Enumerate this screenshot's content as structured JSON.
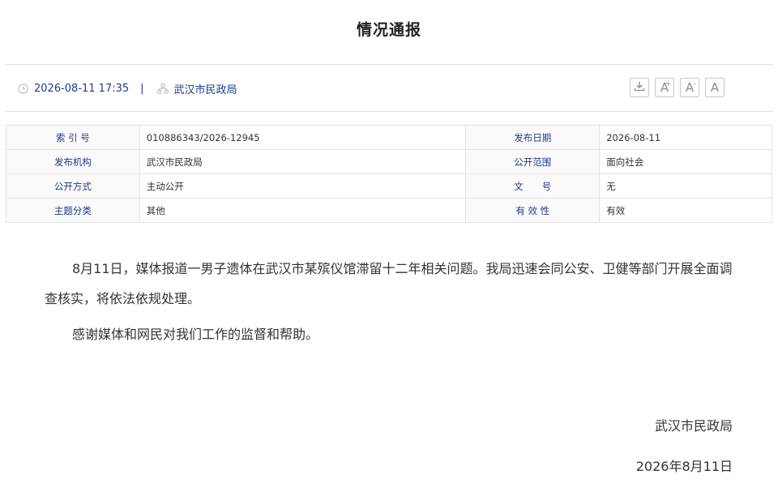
{
  "page_title": "情况通报",
  "meta": {
    "datetime": "2026-08-11 17:35",
    "separator": "|",
    "source": "武汉市民政局"
  },
  "toolbar": {
    "download_icon": "download-icon",
    "font_increase_label": "A",
    "font_increase_mark": "+",
    "font_decrease_label": "A",
    "font_decrease_mark": "-",
    "font_reset_label": "A"
  },
  "info_table": {
    "rows": [
      {
        "k1": "索 引 号",
        "v1": "010886343/2026-12945",
        "k2": "发布日期",
        "v2": "2026-08-11"
      },
      {
        "k1": "发布机构",
        "v1": "武汉市民政局",
        "k2": "公开范围",
        "v2": "面向社会"
      },
      {
        "k1": "公开方式",
        "v1": "主动公开",
        "k2": "文　　号",
        "v2": "无"
      },
      {
        "k1": "主题分类",
        "v1": "其他",
        "k2": "有 效 性",
        "v2": "有效"
      }
    ]
  },
  "content": {
    "paragraphs": [
      "8月11日，媒体报道一男子遗体在武汉市某殡仪馆滞留十二年相关问题。我局迅速会同公安、卫健等部门开展全面调查核实，将依法依规处理。",
      "感谢媒体和网民对我们工作的监督和帮助。"
    ]
  },
  "signature": {
    "org": "武汉市民政局",
    "date": "2026年8月11日"
  }
}
